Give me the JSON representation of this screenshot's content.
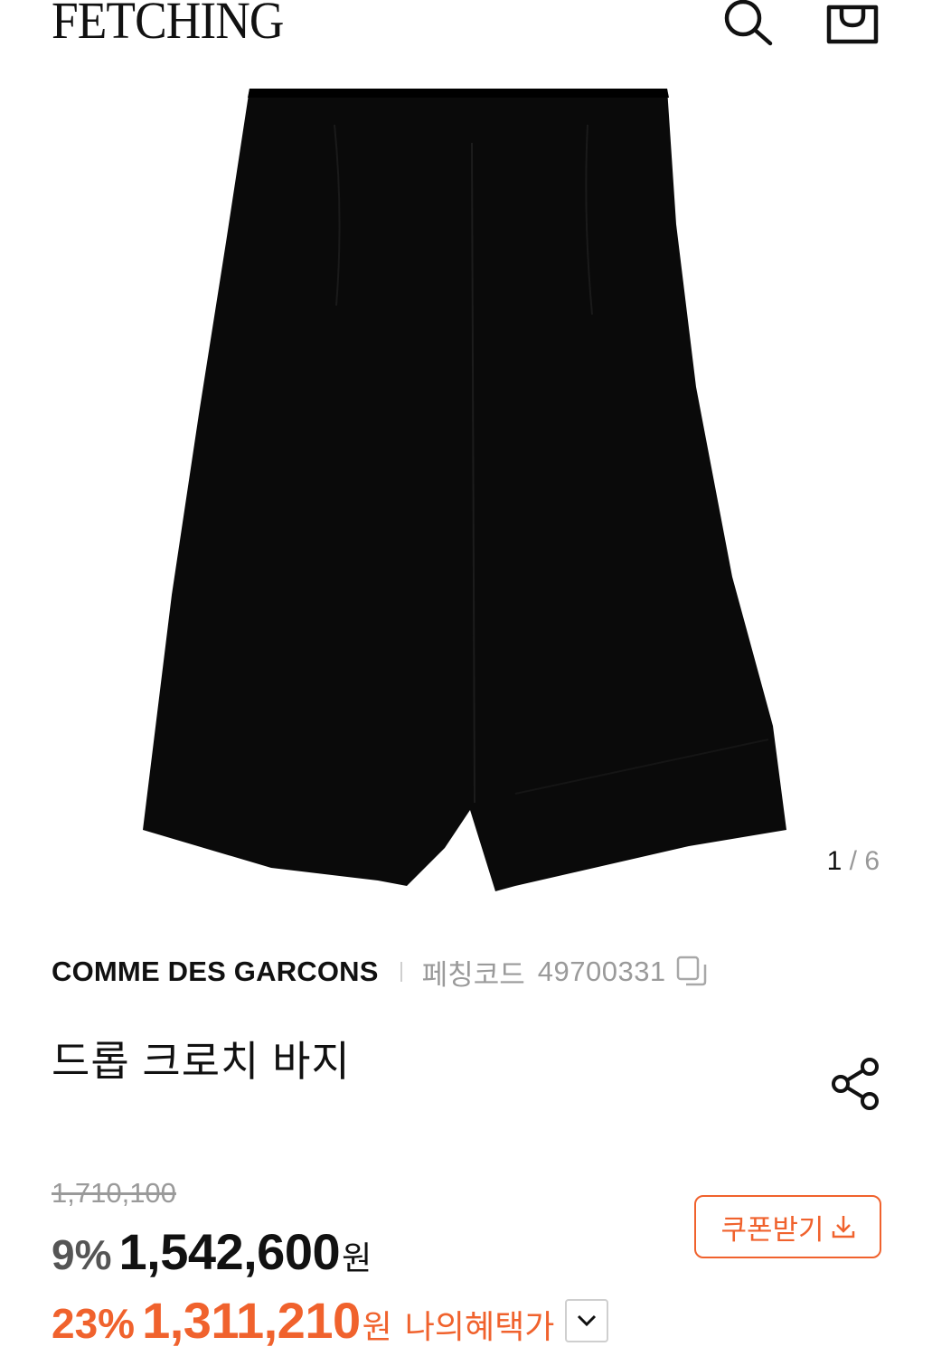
{
  "header": {
    "logo": "FETCHING",
    "icons": [
      "search-icon",
      "shopping-bag-icon"
    ]
  },
  "gallery": {
    "current": "1",
    "separator": " / ",
    "total": "6"
  },
  "product": {
    "brand": "COMME DES GARCONS",
    "code_label": "페칭코드",
    "code_value": "49700331",
    "name": "드롭 크로치 바지"
  },
  "pricing": {
    "original_price": "1,710,100",
    "discount_rate": "9%",
    "sale_price": "1,542,600",
    "currency": "원",
    "coupon_button": "쿠폰받기",
    "benefit_discount_rate": "23%",
    "benefit_price": "1,311,210",
    "benefit_currency": "원",
    "benefit_label": "나의혜택가"
  },
  "colors": {
    "accent": "#f0622d",
    "text": "#111111",
    "muted": "#9a9a9a"
  }
}
